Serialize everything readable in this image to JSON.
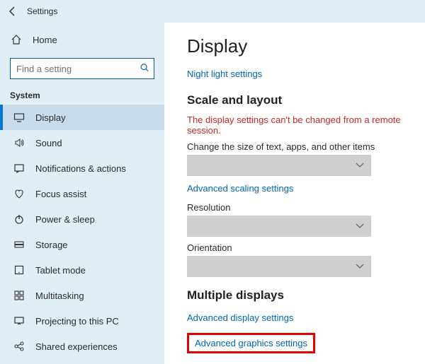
{
  "window": {
    "title": "Settings"
  },
  "sidebar": {
    "home": "Home",
    "search_placeholder": "Find a setting",
    "section": "System",
    "items": [
      {
        "label": "Display"
      },
      {
        "label": "Sound"
      },
      {
        "label": "Notifications & actions"
      },
      {
        "label": "Focus assist"
      },
      {
        "label": "Power & sleep"
      },
      {
        "label": "Storage"
      },
      {
        "label": "Tablet mode"
      },
      {
        "label": "Multitasking"
      },
      {
        "label": "Projecting to this PC"
      },
      {
        "label": "Shared experiences"
      }
    ]
  },
  "content": {
    "title": "Display",
    "night_light_link": "Night light settings",
    "scale_heading": "Scale and layout",
    "remote_warning": "The display settings can't be changed from a remote session.",
    "scale_label": "Change the size of text, apps, and other items",
    "advanced_scaling_link": "Advanced scaling settings",
    "resolution_label": "Resolution",
    "orientation_label": "Orientation",
    "multi_heading": "Multiple displays",
    "adv_display_link": "Advanced display settings",
    "adv_graphics_link": "Advanced graphics settings"
  }
}
